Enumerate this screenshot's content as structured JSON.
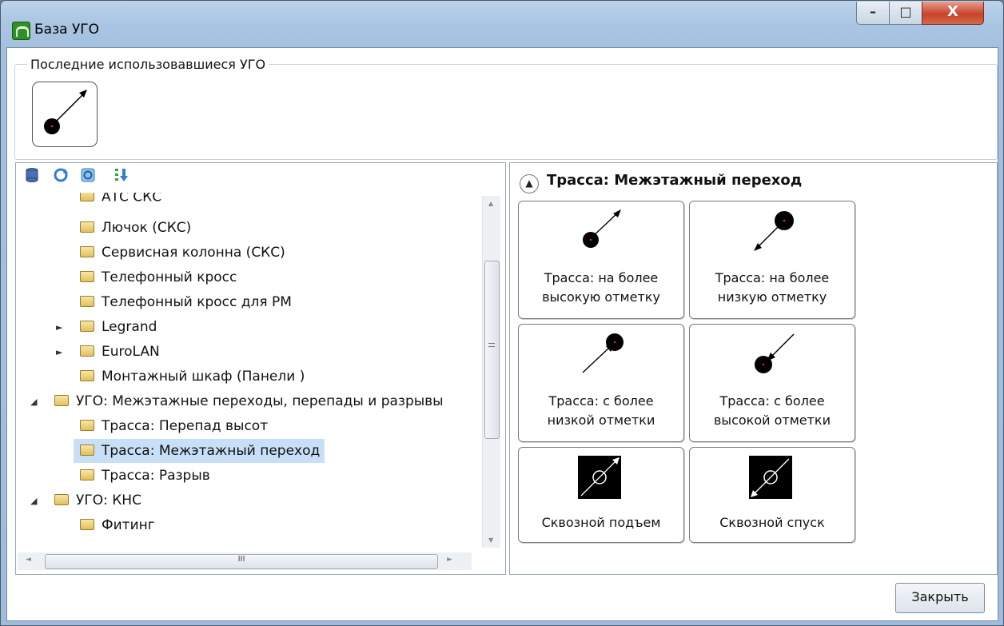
{
  "window": {
    "title": "База УГО"
  },
  "controls": {
    "minimize": "–",
    "maximize": "□",
    "close": "X"
  },
  "recent": {
    "title": "Последние использовавшиеся УГО",
    "item_icon": "arrow-up-dot-icon"
  },
  "toolbar": {
    "icons": [
      "database-icon",
      "refresh-icon",
      "sync-icon",
      "sort-icon"
    ]
  },
  "tree": {
    "items": [
      {
        "label": "АТС СКС"
      },
      {
        "label": "Лючок (СКС)"
      },
      {
        "label": "Сервисная колонна (СКС)"
      },
      {
        "label": "Телефонный кросс"
      },
      {
        "label": "Телефонный кросс для РМ"
      },
      {
        "label": "Legrand"
      },
      {
        "label": "EuroLAN"
      },
      {
        "label": "Монтажный шкаф (Панели )"
      },
      {
        "label": "УГО: Межэтажные переходы, перепады и разрывы"
      },
      {
        "label": "Трасса: Перепад высот"
      },
      {
        "label": "Трасса: Межэтажный переход"
      },
      {
        "label": "Трасса: Разрыв"
      },
      {
        "label": "УГО: КНС"
      },
      {
        "label": "Фитинг"
      }
    ],
    "scroll_grip": "III"
  },
  "section": {
    "title": "Трасса: Межэтажный переход"
  },
  "tiles": [
    {
      "line1": "Трасса: на более",
      "line2": "высокую отметку",
      "icon": "arrow-up-from-dot-icon"
    },
    {
      "line1": "Трасса: на более",
      "line2": "низкую отметку",
      "icon": "arrow-down-to-dot-icon"
    },
    {
      "line1": "Трасса: с более",
      "line2": "низкой отметки",
      "icon": "arrow-up-to-dot-icon"
    },
    {
      "line1": "Трасса: с более",
      "line2": "высокой отметки",
      "icon": "arrow-down-from-dot-icon"
    },
    {
      "line1": "Сквозной подъем",
      "line2": "",
      "icon": "through-up-icon"
    },
    {
      "line1": "Сквозной спуск",
      "line2": "",
      "icon": "through-down-icon"
    }
  ],
  "footer": {
    "close_button": "Закрыть"
  }
}
